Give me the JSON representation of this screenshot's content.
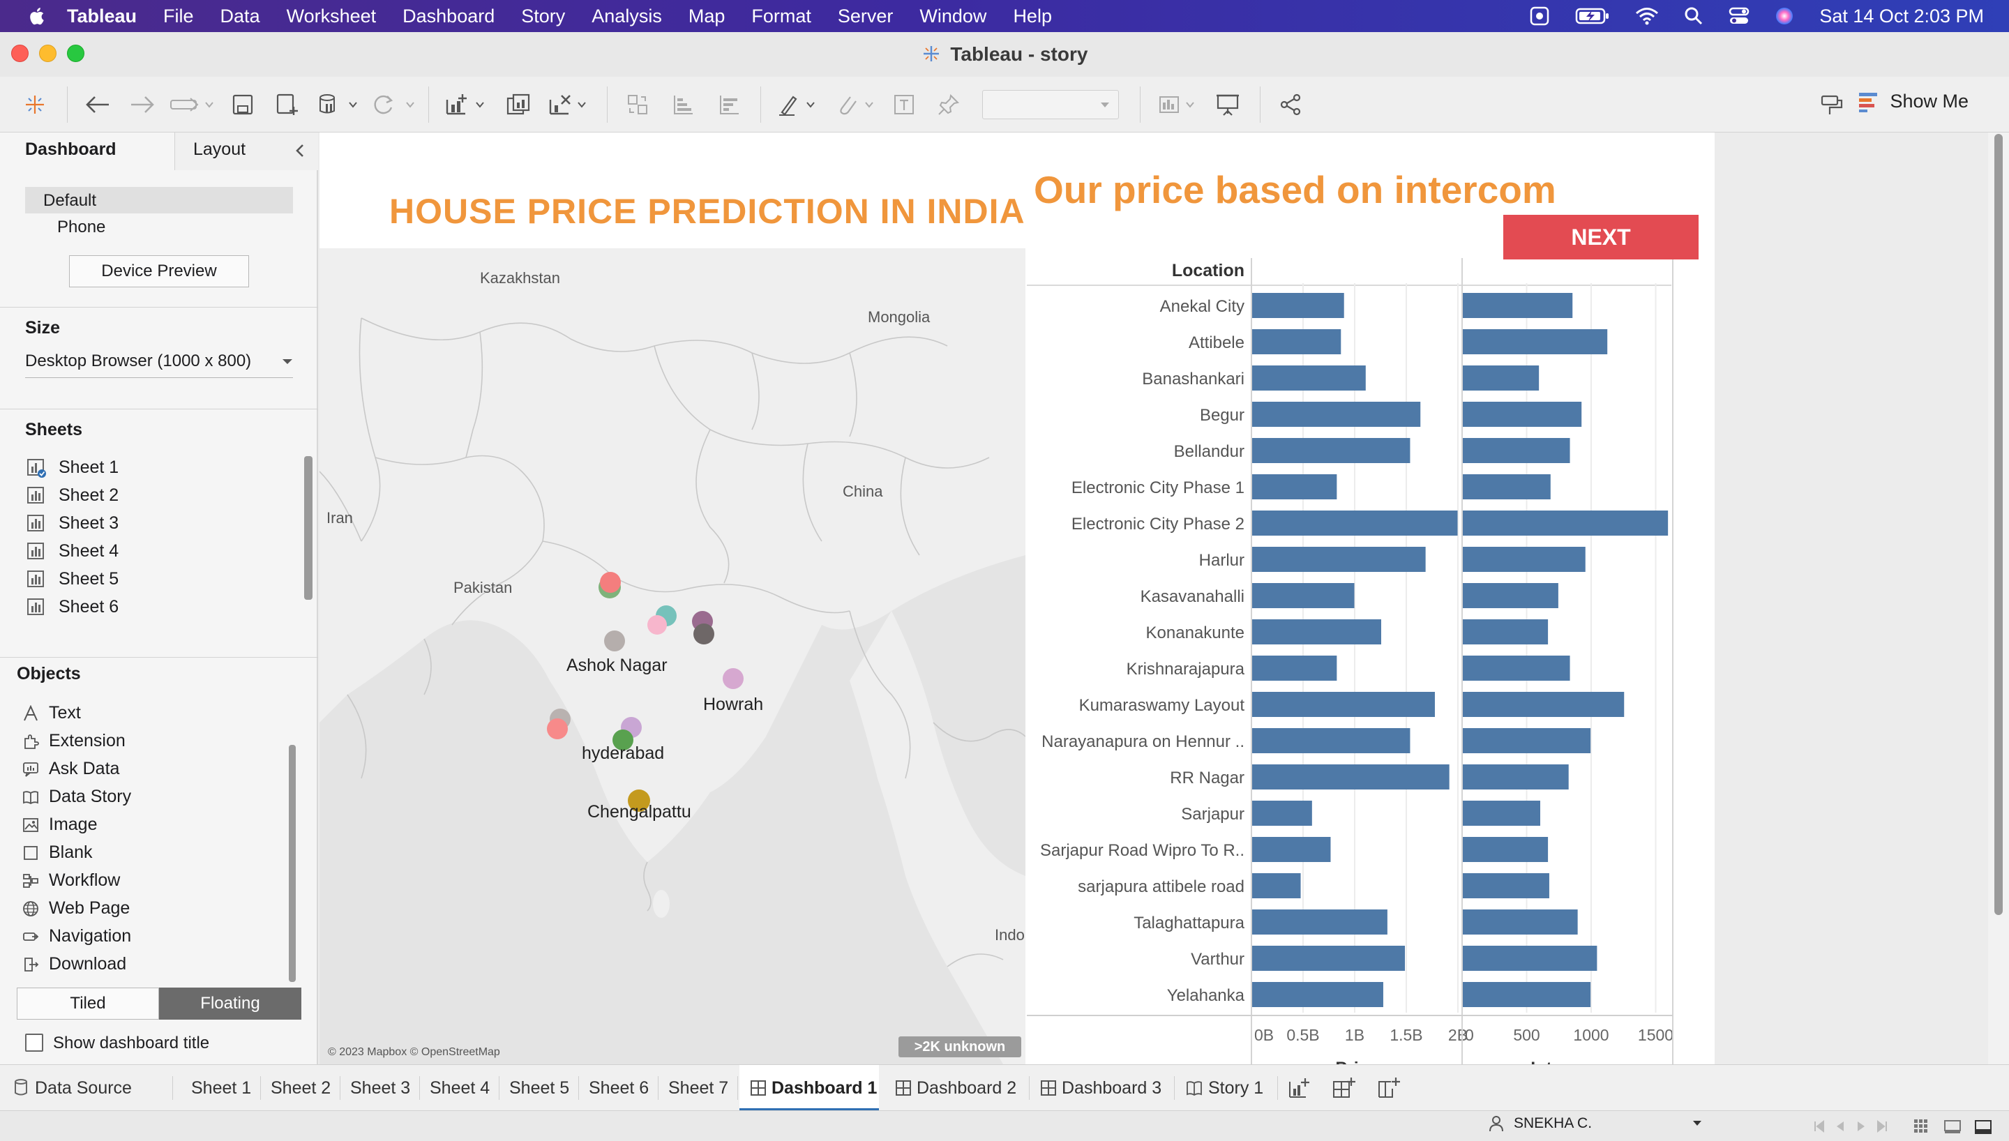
{
  "menubar": {
    "app": "Tableau",
    "items": [
      "File",
      "Data",
      "Worksheet",
      "Dashboard",
      "Story",
      "Analysis",
      "Map",
      "Format",
      "Server",
      "Window",
      "Help"
    ],
    "datetime": "Sat 14 Oct  2:03 PM"
  },
  "window": {
    "title": "Tableau - story"
  },
  "toolbar": {
    "show_me_label": "Show Me"
  },
  "left_pane": {
    "tab_dashboard": "Dashboard",
    "tab_layout": "Layout",
    "devices": [
      "Default",
      "Phone"
    ],
    "device_preview_label": "Device Preview",
    "size_title": "Size",
    "size_value": "Desktop Browser (1000 x 800)",
    "sheets_title": "Sheets",
    "sheets": [
      "Sheet 1",
      "Sheet 2",
      "Sheet 3",
      "Sheet 4",
      "Sheet 5",
      "Sheet 6"
    ],
    "objects_title": "Objects",
    "objects": [
      {
        "label": "Text",
        "icon": "text-icon"
      },
      {
        "label": "Extension",
        "icon": "extension-icon"
      },
      {
        "label": "Ask Data",
        "icon": "ask-data-icon"
      },
      {
        "label": "Data Story",
        "icon": "data-story-icon"
      },
      {
        "label": "Image",
        "icon": "image-icon"
      },
      {
        "label": "Blank",
        "icon": "blank-icon"
      },
      {
        "label": "Workflow",
        "icon": "workflow-icon"
      },
      {
        "label": "Web Page",
        "icon": "globe-icon"
      },
      {
        "label": "Navigation",
        "icon": "navigation-icon"
      },
      {
        "label": "Download",
        "icon": "download-icon"
      }
    ],
    "tiled_label": "Tiled",
    "floating_label": "Floating",
    "show_title_label": "Show dashboard title"
  },
  "dashboard": {
    "title": "HOUSE PRICE PREDICTION IN INDIA",
    "map": {
      "country_labels": [
        "Kazakhstan",
        "Mongolia",
        "China",
        "Iran",
        "Pakistan",
        "Indo"
      ],
      "city_labels": [
        "Ashok Nagar",
        "Howrah",
        "hyderabad",
        "Chengalpattu"
      ],
      "copyright": "© 2023 Mapbox © OpenStreetMap",
      "unknown_badge": ">2K unknown"
    },
    "chart_title": "Our price based on intercom",
    "next_button": "NEXT"
  },
  "chart_data": {
    "type": "bar",
    "orientation": "horizontal",
    "row_header": "Location",
    "categories": [
      "Anekal City",
      "Attibele",
      "Banashankari",
      "Begur",
      "Bellandur",
      "Electronic City Phase 1",
      "Electronic City Phase 2",
      "Harlur",
      "Kasavanahalli",
      "Konanakunte",
      "Krishnarajapura",
      "Kumaraswamy Layout",
      "Narayanapura on Hennur ..",
      "RR Nagar",
      "Sarjapur",
      "Sarjapur Road Wipro To R..",
      "sarjapura attibele road",
      "Talaghattapura",
      "Varthur",
      "Yelahanka"
    ],
    "series": [
      {
        "name": "Price",
        "xlim": [
          0,
          2000000000
        ],
        "ticks": [
          "0B",
          "0.5B",
          "1B",
          "1.5B",
          "2B"
        ],
        "values": [
          890000000,
          860000000,
          1100000000,
          1630000000,
          1530000000,
          820000000,
          1990000000,
          1680000000,
          990000000,
          1250000000,
          820000000,
          1770000000,
          1530000000,
          1910000000,
          580000000,
          760000000,
          470000000,
          1310000000,
          1480000000,
          1270000000
        ]
      },
      {
        "name": "Intercom",
        "xlim": [
          0,
          1600
        ],
        "ticks": [
          "0",
          "500",
          "1000",
          "1500"
        ],
        "values": [
          850,
          1120,
          590,
          920,
          830,
          680,
          1590,
          950,
          740,
          660,
          830,
          1250,
          990,
          820,
          600,
          660,
          670,
          890,
          1040,
          990
        ]
      }
    ],
    "bar_color": "#4e79a7"
  },
  "bottom_tabs": {
    "data_source": "Data Source",
    "tabs": [
      {
        "label": "Sheet 1",
        "kind": "sheet"
      },
      {
        "label": "Sheet 2",
        "kind": "sheet"
      },
      {
        "label": "Sheet 3",
        "kind": "sheet"
      },
      {
        "label": "Sheet 4",
        "kind": "sheet"
      },
      {
        "label": "Sheet 5",
        "kind": "sheet"
      },
      {
        "label": "Sheet 6",
        "kind": "sheet"
      },
      {
        "label": "Sheet 7",
        "kind": "sheet"
      },
      {
        "label": "Dashboard 1",
        "kind": "dashboard",
        "active": true
      },
      {
        "label": "Dashboard 2",
        "kind": "dashboard"
      },
      {
        "label": "Dashboard 3",
        "kind": "dashboard"
      },
      {
        "label": "Story 1",
        "kind": "story"
      }
    ]
  },
  "status": {
    "user": "SNEKHA C."
  },
  "colors": {
    "accent_orange": "#f0963c",
    "next_red": "#e34b52",
    "tab_accent": "#2f6fb3"
  }
}
